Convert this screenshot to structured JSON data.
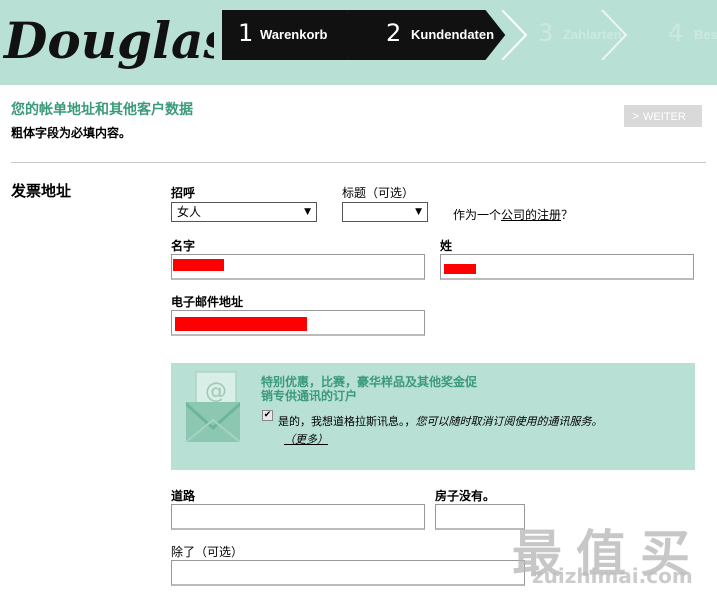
{
  "header": {
    "logo_text": "Douglas",
    "steps": [
      {
        "num": "1",
        "label": "Warenkorb"
      },
      {
        "num": "2",
        "label": "Kundendaten"
      },
      {
        "num": "3",
        "label": "Zahlarten"
      },
      {
        "num": "4",
        "label": "Bes"
      }
    ]
  },
  "page": {
    "title": "您的帐单地址和其他客户数据",
    "required_note": "粗体字段为必填内容。",
    "weiter_label": "WEITER",
    "section_title": "发票地址"
  },
  "form": {
    "salutation_label": "招呼",
    "salutation_value": "女人",
    "title_label": "标题（可选）",
    "title_value": "",
    "company_question_pre": "作为一个",
    "company_question_link": "公司的注册",
    "company_question_post": "？",
    "firstname_label": "名字",
    "lastname_label": "姓",
    "email_label": "电子邮件地址",
    "street_label": "道路",
    "house_label": "房子没有。",
    "addition_label": "除了（可选）"
  },
  "newsletter": {
    "title": "特别优惠，比赛，豪华样品及其他奖金促销专供通讯的订户",
    "checkbox_checked": true,
    "text": "是的，我想道格拉斯讯息。，",
    "text_italic": "您可以随时取消订阅使用的通讯服务。",
    "more": "（更多）"
  },
  "watermark": {
    "chars": "最值买",
    "url": "zuizhimai.com"
  },
  "colors": {
    "accent_green": "#3a9a7a",
    "header_bg": "#b8e0d4",
    "step_active": "#111111",
    "redaction": "#ff0000"
  }
}
